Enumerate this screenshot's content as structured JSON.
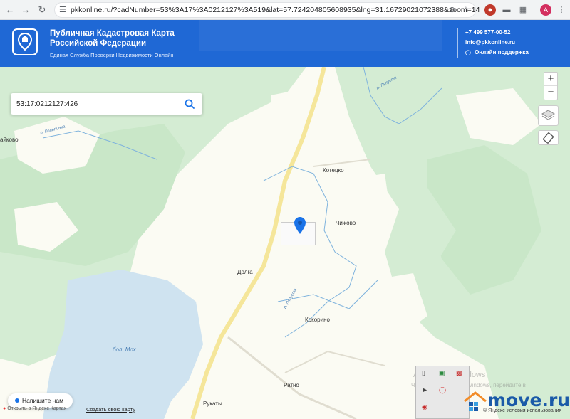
{
  "browser": {
    "url": "pkkonline.ru/?cadNumber=53%3A17%3A0212127%3A519&lat=57.724204805608935&lng=31.16729021072388&zoom=14",
    "profile_initial": "A"
  },
  "header": {
    "title_line1": "Публичная Кадастровая Карта",
    "title_line2": "Российской Федерации",
    "tagline": "Единая Служба Проверки Недвижимости Онлайн",
    "phone": "+7 499 577-00-52",
    "email": "info@pkkonline.ru",
    "support": "Онлайн поддержка"
  },
  "map": {
    "search_value": "53:17:0212127:426",
    "zoom_in": "+",
    "zoom_out": "−",
    "places": {
      "kotetsko": "Котецко",
      "chizhovo": "Чижово",
      "dolga": "Долга",
      "kokorino": "Кокорино",
      "ratno": "Ратно",
      "rukaty": "Рукаты",
      "left_partial": "айково"
    },
    "water_labels": {
      "lake": "бол. Мох",
      "river_kolpinka": "р. Кольпинка",
      "river_top": "р. Ляпуста",
      "river_mid": "р. Ляпуста"
    }
  },
  "footer": {
    "chat_label": "Напишите нам",
    "yandex_open": "Открыть в Яндекс Картах",
    "yandex_create": "Создать свою карту",
    "windows_watermark_1": "Активация Windows",
    "windows_watermark_2": "Чтобы активировать Windows, перейдите в",
    "moveru_logo": "move.ru",
    "yandex_terms": "© Яндекс Условия использования"
  },
  "colors": {
    "header_bg": "#1f68d5",
    "forest": "#d4ecd3",
    "water": "#cfe3f0",
    "road": "#f5e69a",
    "marker": "#1a73e8"
  }
}
